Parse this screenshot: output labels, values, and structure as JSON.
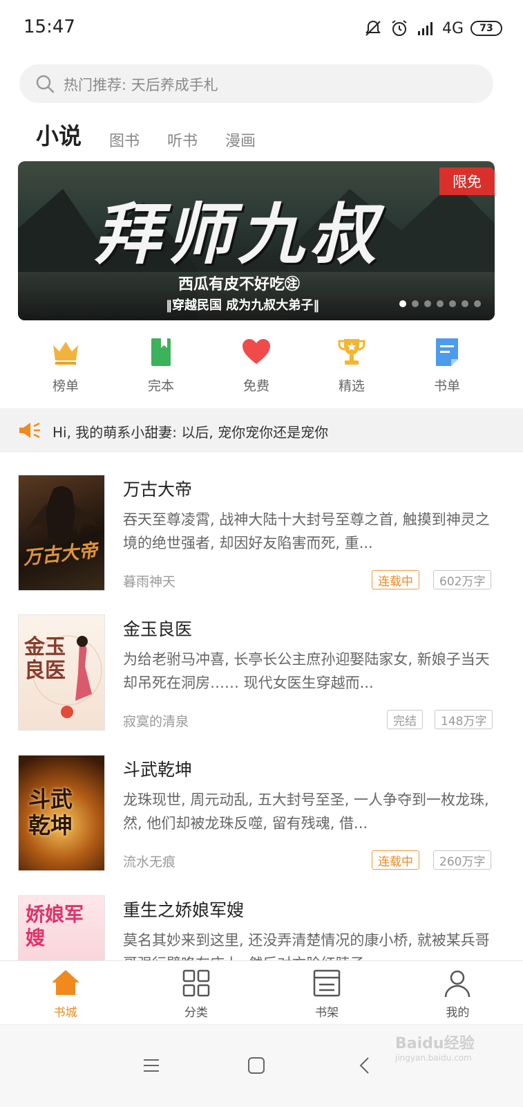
{
  "status_bar": {
    "time": "15:47",
    "network": "4G",
    "battery": "73"
  },
  "search": {
    "placeholder": "热门推荐: 天后养成手札"
  },
  "tabs": [
    {
      "label": "小说",
      "active": true
    },
    {
      "label": "图书",
      "active": false
    },
    {
      "label": "听书",
      "active": false
    },
    {
      "label": "漫画",
      "active": false
    }
  ],
  "banner": {
    "title": "拜师九叔",
    "author_line": "西瓜有皮不好吃㊟",
    "tagline": "‖穿越民国 成为九叔大弟子‖",
    "badge": "限免",
    "page_count": 7,
    "active_page": 1
  },
  "quick_nav": [
    {
      "label": "榜单",
      "icon": "crown-icon",
      "color": "#f2b33d"
    },
    {
      "label": "完本",
      "icon": "bookmark-book-icon",
      "color": "#3cb35a"
    },
    {
      "label": "免费",
      "icon": "heart-icon",
      "color": "#ef4b4b"
    },
    {
      "label": "精选",
      "icon": "trophy-icon",
      "color": "#f5b52e"
    },
    {
      "label": "书单",
      "icon": "booklist-icon",
      "color": "#4c9bec"
    }
  ],
  "notice": {
    "text": "Hi, 我的萌系小甜妻: 以后, 宠你宠你还是宠你"
  },
  "books": [
    {
      "title": "万古大帝",
      "desc": "吞天至尊凌霄, 战神大陆十大封号至尊之首, 触摸到神灵之境的绝世强者, 却因好友陷害而死, 重...",
      "author": "暮雨神天",
      "status": "连载中",
      "words": "602万字",
      "cover_text": "万古大帝"
    },
    {
      "title": "金玉良医",
      "desc": "为给老驸马冲喜, 长亭长公主庶孙迎娶陆家女, 新娘子当天却吊死在洞房…… 现代女医生穿越而...",
      "author": "寂寞的清泉",
      "status": "完结",
      "words": "148万字",
      "cover_text": "金玉良医"
    },
    {
      "title": "斗武乾坤",
      "desc": "龙珠现世, 周元动乱, 五大封号至圣, 一人争夺到一枚龙珠, 然, 他们却被龙珠反噬, 留有残魂, 借...",
      "author": "流水无痕",
      "status": "连载中",
      "words": "260万字",
      "cover_text": "斗武乾坤"
    },
    {
      "title": "重生之娇娘军嫂",
      "desc": "莫名其妙来到这里, 还没弄清楚情况的康小桥, 就被某兵哥哥强行壁咚在床上, 然后对方脸红脖子...",
      "author": "",
      "status": "",
      "words": "",
      "cover_text": "娇娘军嫂"
    }
  ],
  "tabbar": [
    {
      "label": "书城",
      "icon": "home-icon",
      "active": true
    },
    {
      "label": "分类",
      "icon": "grid-icon",
      "active": false
    },
    {
      "label": "书架",
      "icon": "bookshelf-icon",
      "active": false
    },
    {
      "label": "我的",
      "icon": "person-icon",
      "active": false
    }
  ],
  "watermark": {
    "brand": "Baidu经验",
    "url": "jingyan.baidu.com"
  },
  "colors": {
    "accent": "#f08a1c",
    "badge_red": "#d9302c"
  }
}
